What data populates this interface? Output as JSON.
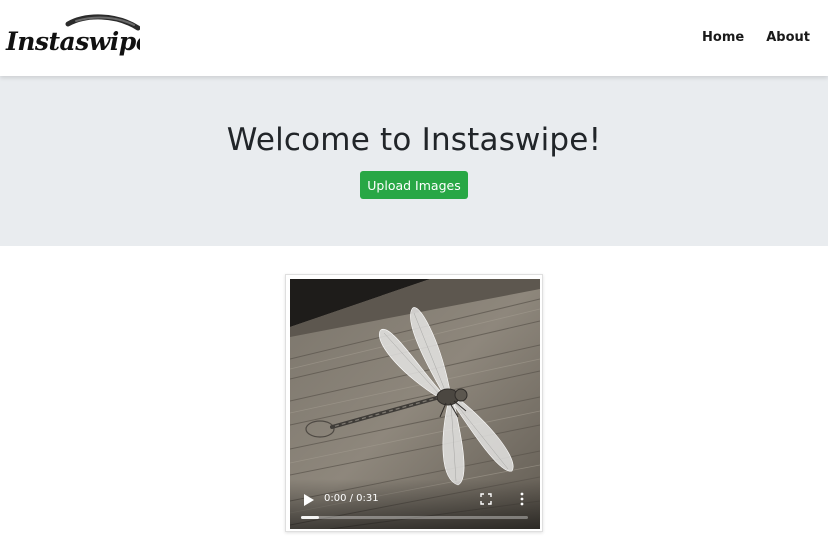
{
  "app": {
    "logo_text": "Instaswipe"
  },
  "nav": {
    "items": [
      {
        "label": "Home"
      },
      {
        "label": "About"
      }
    ]
  },
  "hero": {
    "title": "Welcome to Instaswipe!",
    "upload_label": "Upload Images",
    "background_color": "#e9ecef",
    "button_color": "#28a745"
  },
  "video": {
    "time": "0:00 / 0:31",
    "progress": 0.08,
    "icons": [
      "play-icon",
      "fullscreen-icon",
      "more-options-icon"
    ]
  }
}
